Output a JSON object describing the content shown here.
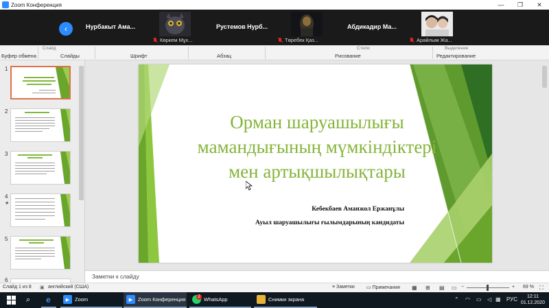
{
  "zoom": {
    "window_title": "Zoom Конференция",
    "participants": [
      {
        "name": "Нурбакыт  Ама...",
        "caption": ""
      },
      {
        "name": "",
        "caption": "Көркем Мұх..."
      },
      {
        "name": "Рустемов  Нурб...",
        "caption": ""
      },
      {
        "name": "",
        "caption": "Төребек Қаз..."
      },
      {
        "name": "Абдикадир  Ма...",
        "caption": ""
      },
      {
        "name": "",
        "caption": "Арайлым Жа..."
      }
    ]
  },
  "ribbon": {
    "groups": [
      "Буфер обмена",
      "Слайды",
      "Шрифт",
      "Абзац",
      "Рисование",
      "Редактирование"
    ],
    "partial_labels": [
      "Слайд",
      "Стили",
      "Выделение"
    ]
  },
  "thumbnails": {
    "numbers": [
      "1",
      "2",
      "3",
      "4",
      "5",
      "6"
    ],
    "star": "★"
  },
  "slide": {
    "title_lines": [
      "Орман шаруашылығы",
      "мамандығының мүмкіндіктері",
      "мен артықшылықтары"
    ],
    "author": "Кебекбаев Аманжол Ержанұлы",
    "degree": "Ауыл шаруашылығы ғылымдарының кандидаты"
  },
  "notes": {
    "placeholder": "Заметки к слайду"
  },
  "status": {
    "slide_counter": "Слайд 1 из 8",
    "language": "английский (США)",
    "notes_btn": "Заметки",
    "comments_btn": "Примечания",
    "zoom_level": "69 %",
    "zoom_minus": "−",
    "zoom_plus": "+"
  },
  "taskbar": {
    "apps": [
      "Zoom",
      "Zoom Конференция",
      "WhatsApp",
      "Снимки экрана"
    ],
    "whatsapp_badge": "2",
    "lang": "РУС",
    "time": "12:11",
    "date": "01.12.2020"
  },
  "colors": {
    "slide_green": "#85b43a",
    "zoom_blue": "#2d8cff",
    "mute_red": "#e02828"
  }
}
